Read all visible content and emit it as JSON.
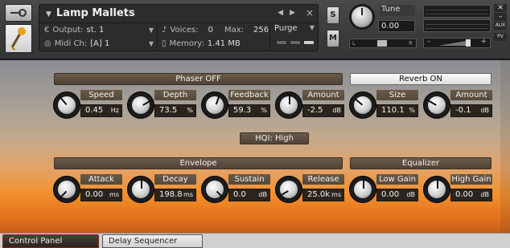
{
  "header": {
    "instrument": {
      "title": "Lamp Mallets",
      "output_label": "Output:",
      "output_value": "st. 1",
      "midi_label": "Midi Ch:",
      "midi_value": "[A]  1",
      "voices_label": "Voices:",
      "voices_value": "0",
      "max_label": "Max:",
      "max_value": "256",
      "memory_label": "Memory:",
      "memory_value": "1.41 MB",
      "purge_label": "Purge"
    },
    "solo_label": "S",
    "mute_label": "M",
    "tune": {
      "label": "Tune",
      "value": "0.00"
    },
    "pan": {
      "left": "L",
      "right": "R"
    },
    "volume": {
      "minus": "–",
      "plus": "+"
    },
    "side": {
      "aux": "AUX",
      "pv": "PV"
    }
  },
  "phaser": {
    "title": "Phaser OFF",
    "modules": [
      {
        "label": "Speed",
        "value": "0.45",
        "unit": "Hz"
      },
      {
        "label": "Depth",
        "value": "73.5",
        "unit": "%"
      },
      {
        "label": "Feedback",
        "value": "59.3",
        "unit": "%"
      },
      {
        "label": "Amount",
        "value": "-2.5",
        "unit": "dB"
      }
    ]
  },
  "reverb": {
    "title": "Reverb ON",
    "modules": [
      {
        "label": "Size",
        "value": "110.1",
        "unit": "%"
      },
      {
        "label": "Amount",
        "value": "-0.1",
        "unit": "dB"
      }
    ]
  },
  "hqi_label": "HQI: High",
  "envelope": {
    "title": "Envelope",
    "modules": [
      {
        "label": "Attack",
        "value": "0.00",
        "unit": "ms"
      },
      {
        "label": "Decay",
        "value": "198.8",
        "unit": "ms"
      },
      {
        "label": "Sustain",
        "value": "0.0",
        "unit": "dB"
      },
      {
        "label": "Release",
        "value": "25.0k",
        "unit": "ms"
      }
    ]
  },
  "equalizer": {
    "title": "Equalizer",
    "modules": [
      {
        "label": "Low Gain",
        "value": "0.00",
        "unit": "dB"
      },
      {
        "label": "High Gain",
        "value": "0.00",
        "unit": "dB"
      }
    ]
  },
  "tabs": {
    "control_panel": "Control Panel",
    "delay_sequencer": "Delay Sequencer"
  }
}
